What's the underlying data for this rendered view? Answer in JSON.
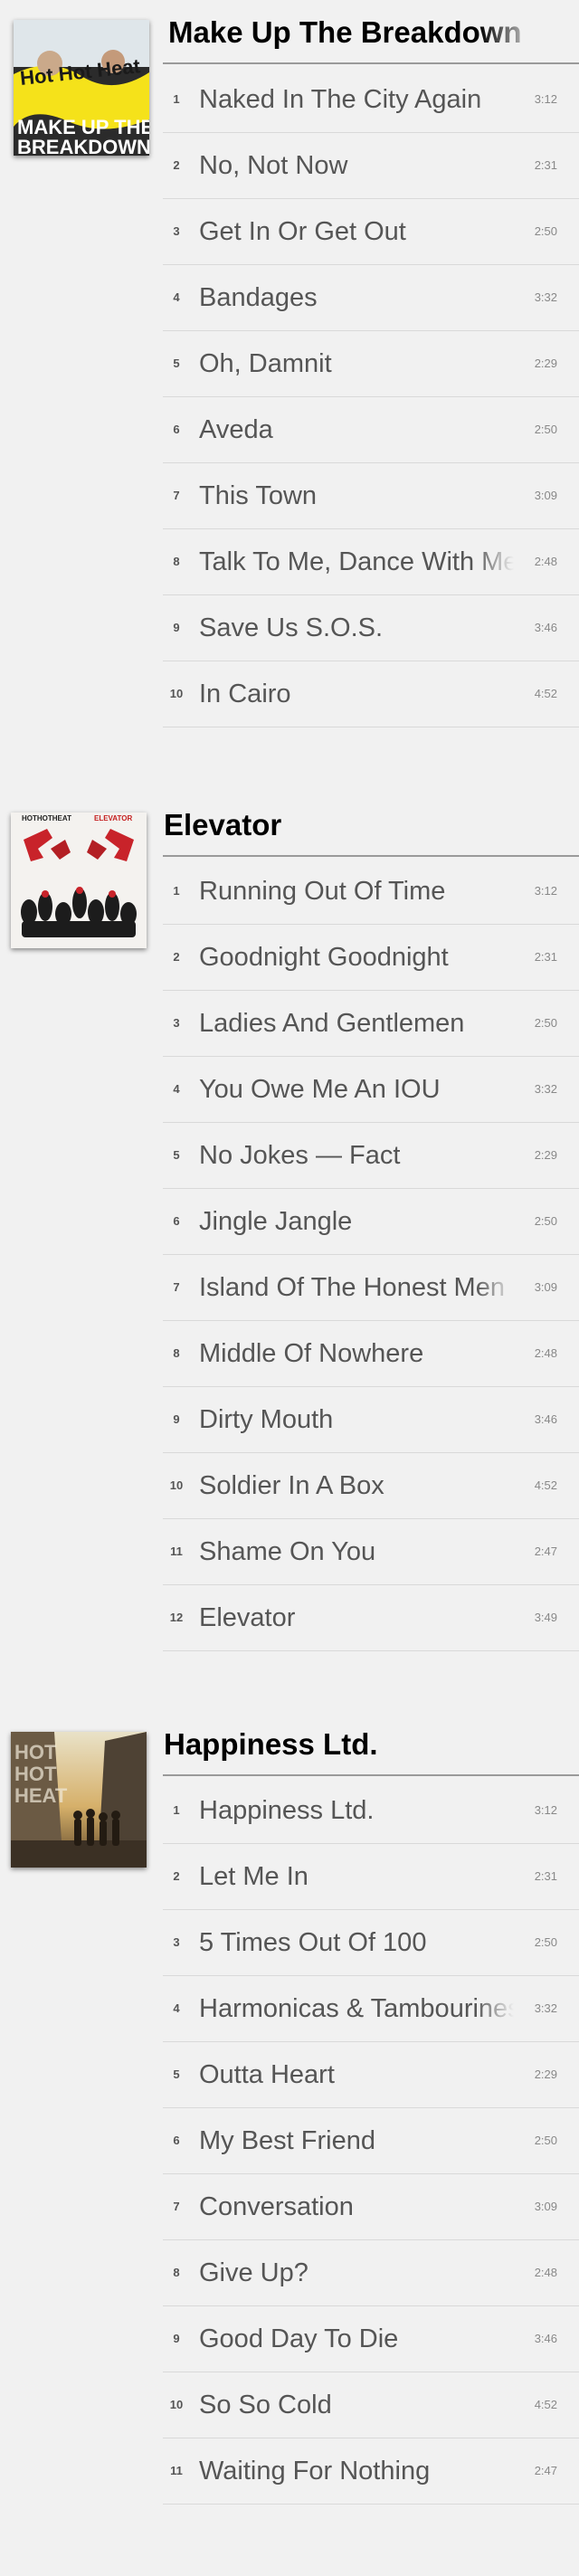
{
  "albums": [
    {
      "title": "Make Up The Breakdown",
      "cover": {
        "band": "Hot Hot Heat",
        "caption_1": "MAKE UP THE",
        "caption_2": "BREAKDOWN"
      },
      "tracks": [
        {
          "number": "1",
          "title": "Naked In The City Again",
          "duration": "3:12"
        },
        {
          "number": "2",
          "title": "No, Not Now",
          "duration": "2:31"
        },
        {
          "number": "3",
          "title": "Get In Or Get Out",
          "duration": "2:50"
        },
        {
          "number": "4",
          "title": "Bandages",
          "duration": "3:32"
        },
        {
          "number": "5",
          "title": "Oh, Damnit",
          "duration": "2:29"
        },
        {
          "number": "6",
          "title": "Aveda",
          "duration": "2:50"
        },
        {
          "number": "7",
          "title": "This Town",
          "duration": "3:09"
        },
        {
          "number": "8",
          "title": "Talk To Me, Dance With Me",
          "duration": "2:48"
        },
        {
          "number": "9",
          "title": "Save Us S.O.S.",
          "duration": "3:46"
        },
        {
          "number": "10",
          "title": "In Cairo",
          "duration": "4:52"
        }
      ]
    },
    {
      "title": "Elevator",
      "cover": {
        "band": "HOTHOTHEAT",
        "album": "ELEVATOR"
      },
      "tracks": [
        {
          "number": "1",
          "title": "Running Out Of Time",
          "duration": "3:12"
        },
        {
          "number": "2",
          "title": "Goodnight Goodnight",
          "duration": "2:31"
        },
        {
          "number": "3",
          "title": "Ladies And Gentlemen",
          "duration": "2:50"
        },
        {
          "number": "4",
          "title": "You Owe Me An IOU",
          "duration": "3:32"
        },
        {
          "number": "5",
          "title": "No Jokes — Fact",
          "duration": "2:29"
        },
        {
          "number": "6",
          "title": "Jingle Jangle",
          "duration": "2:50"
        },
        {
          "number": "7",
          "title": "Island Of The Honest Men",
          "duration": "3:09"
        },
        {
          "number": "8",
          "title": "Middle Of Nowhere",
          "duration": "2:48"
        },
        {
          "number": "9",
          "title": "Dirty Mouth",
          "duration": "3:46"
        },
        {
          "number": "10",
          "title": "Soldier In A Box",
          "duration": "4:52"
        },
        {
          "number": "11",
          "title": "Shame On You",
          "duration": "2:47"
        },
        {
          "number": "12",
          "title": "Elevator",
          "duration": "3:49"
        }
      ]
    },
    {
      "title": "Happiness Ltd.",
      "cover": {
        "band_line_1": "HOT",
        "band_line_2": "HOT",
        "band_line_3": "HEAT"
      },
      "tracks": [
        {
          "number": "1",
          "title": "Happiness Ltd.",
          "duration": "3:12"
        },
        {
          "number": "2",
          "title": "Let Me In",
          "duration": "2:31"
        },
        {
          "number": "3",
          "title": "5 Times Out Of 100",
          "duration": "2:50"
        },
        {
          "number": "4",
          "title": "Harmonicas & Tambourines",
          "duration": "3:32"
        },
        {
          "number": "5",
          "title": "Outta Heart",
          "duration": "2:29"
        },
        {
          "number": "6",
          "title": "My Best Friend",
          "duration": "2:50"
        },
        {
          "number": "7",
          "title": "Conversation",
          "duration": "3:09"
        },
        {
          "number": "8",
          "title": "Give Up?",
          "duration": "2:48"
        },
        {
          "number": "9",
          "title": "Good Day To Die",
          "duration": "3:46"
        },
        {
          "number": "10",
          "title": "So So Cold",
          "duration": "4:52"
        },
        {
          "number": "11",
          "title": "Waiting For Nothing",
          "duration": "2:47"
        }
      ]
    }
  ]
}
